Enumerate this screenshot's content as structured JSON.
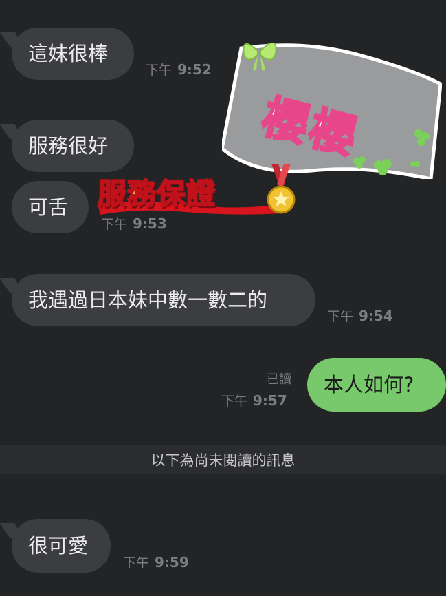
{
  "messages": [
    {
      "text": "這妹很棒",
      "time_prefix": "下午",
      "time": "9:52"
    },
    {
      "text": "服務很好"
    },
    {
      "text": "可舌",
      "time_prefix": "下午",
      "time": "9:53"
    },
    {
      "text": "我遇過日本妹中數一數二的",
      "time_prefix": "下午",
      "time": "9:54"
    },
    {
      "text": "本人如何?",
      "read_label": "已讀",
      "time_prefix": "下午",
      "time": "9:57"
    },
    {
      "text": "很可愛",
      "time_prefix": "下午",
      "time": "9:59"
    }
  ],
  "divider": {
    "label": "以下為尚未閱讀的訊息"
  },
  "stickers": {
    "banner_text": "櫻櫻",
    "guarantee_text": "服務保證"
  },
  "colors": {
    "background": "#232426",
    "incoming_bubble": "#3c3d40",
    "outgoing_bubble": "#78c96b"
  }
}
